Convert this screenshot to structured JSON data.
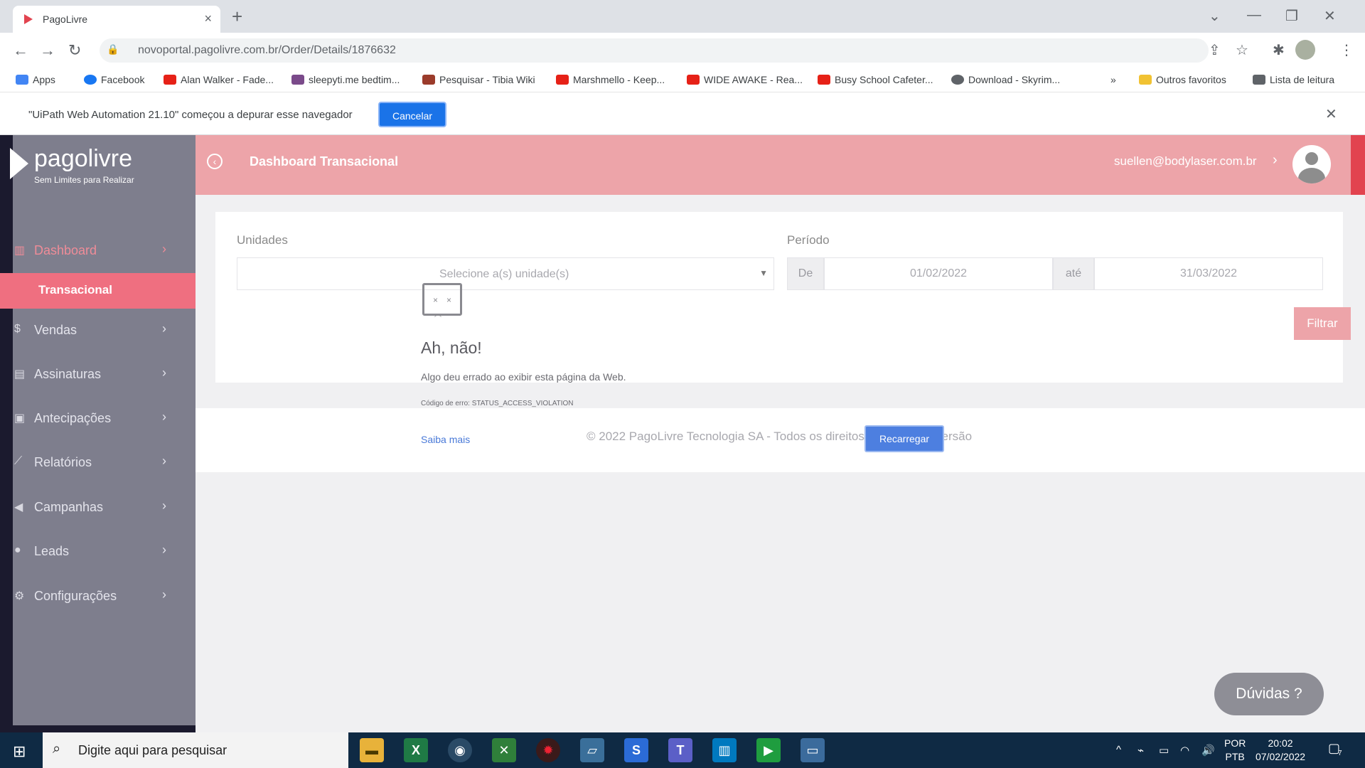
{
  "browser": {
    "tab_title": "PagoLivre",
    "new_tab": "+",
    "url": "novoportal.pagolivre.com.br/Order/Details/1876632",
    "bookmarks": [
      {
        "label": "Apps",
        "color": "#4285f4"
      },
      {
        "label": "Facebook",
        "color": "#1877f2"
      },
      {
        "label": "Alan Walker - Fade...",
        "color": "#e62117"
      },
      {
        "label": "sleepyti.me bedtim...",
        "color": "#7a4a8a"
      },
      {
        "label": "Pesquisar - Tibia Wiki",
        "color": "#9b3b2b"
      },
      {
        "label": "Marshmello - Keep...",
        "color": "#e62117"
      },
      {
        "label": "WIDE AWAKE - Rea...",
        "color": "#e62117"
      },
      {
        "label": "Busy School Cafeter...",
        "color": "#e62117"
      },
      {
        "label": "Download - Skyrim...",
        "color": "#5f6368"
      },
      {
        "label": "Outros favoritos",
        "color": "#f1c232"
      },
      {
        "label": "Lista de leitura",
        "color": "#5f6368"
      }
    ],
    "bookmarks_more": "»",
    "infobar_message": "\"UiPath Web Automation 21.10\" começou a depurar esse navegador",
    "infobar_button": "Cancelar"
  },
  "sidebar": {
    "logo_name": "pagolivre",
    "logo_tagline": "Sem Limites para Realizar",
    "items": [
      {
        "label": "Dashboard",
        "icon": "bar-chart-icon",
        "active": true
      },
      {
        "label": "Vendas",
        "icon": "dollar-icon"
      },
      {
        "label": "Assinaturas",
        "icon": "book-icon"
      },
      {
        "label": "Antecipações",
        "icon": "money-icon"
      },
      {
        "label": "Relatórios",
        "icon": "line-chart-icon"
      },
      {
        "label": "Campanhas",
        "icon": "megaphone-icon"
      },
      {
        "label": "Leads",
        "icon": "users-icon"
      },
      {
        "label": "Configurações",
        "icon": "gears-icon"
      }
    ],
    "submenu_label": "Transacional"
  },
  "header": {
    "title": "Dashboard Transacional",
    "email": "suellen@bodylaser.com.br"
  },
  "filters": {
    "unidades_label": "Unidades",
    "unidades_placeholder": "Selecione a(s) unidade(s)",
    "periodo_label": "Período",
    "de_label": "De",
    "date_from": "01/02/2022",
    "ate_label": "até",
    "date_to": "31/03/2022",
    "filter_button": "Filtrar"
  },
  "crash": {
    "title": "Ah, não!",
    "text": "Algo deu errado ao exibir esta página da Web.",
    "code": "Código de erro: STATUS_ACCESS_VIOLATION",
    "learn_more": "Saiba mais",
    "reload_button": "Recarregar"
  },
  "footer": {
    "text": "© 2022 PagoLivre Tecnologia SA - Todos os direitos reservados. Versão"
  },
  "help_button": "Dúvidas",
  "taskbar": {
    "search_placeholder": "Digite aqui para pesquisar",
    "lang_line1": "POR",
    "lang_line2": "PTB",
    "time": "20:02",
    "date": "07/02/2022",
    "notif_count": "7"
  }
}
